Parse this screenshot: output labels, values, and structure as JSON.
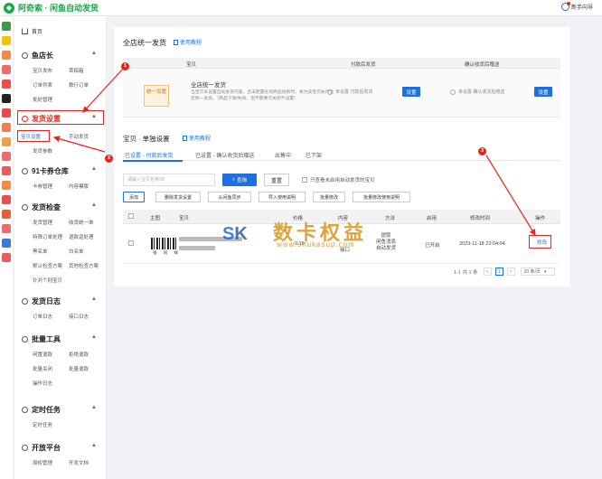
{
  "app": {
    "title": "阿奇索 · 闲鱼自动发货",
    "guide": "新手向导"
  },
  "sidebar": {
    "home": "首页",
    "sections": [
      {
        "title": "鱼店长",
        "items": [
          "宝贝发布",
          "草稿箱",
          "订单列表",
          "数行订单",
          "批处管理"
        ]
      },
      {
        "title": "发货设置",
        "items": [
          "宝贝设置",
          "手动发货",
          "发货参数"
        ]
      },
      {
        "title": "91卡券仓库",
        "items": [
          "卡券管理",
          "内容模版"
        ]
      },
      {
        "title": "发货检查",
        "items": [
          "发货管理",
          "收货统一单",
          "特殊订单处理",
          "退款返处理",
          "黑名单",
          "白名单",
          "默认检查方案",
          "其他检查方案",
          "针对个别宝贝"
        ]
      },
      {
        "title": "发货日志",
        "items": [
          "订单日志",
          "接口日志"
        ]
      },
      {
        "title": "批量工具",
        "items": [
          "闲置退款",
          "拒绝退款",
          "批量关闭",
          "批量退款",
          "操作日志"
        ]
      },
      {
        "title": "定时任务",
        "items": [
          "定时任务"
        ]
      },
      {
        "title": "开放平台",
        "items": [
          "授权管理",
          "开发文档"
        ]
      }
    ]
  },
  "main": {
    "title": "全店统一发货",
    "help_link": "使用教程",
    "store_table": {
      "headers": [
        "宝贝",
        "付款后发货",
        "确认收货后赠送"
      ],
      "unified_tag": "统一设置",
      "desc_title": "全店统一发货",
      "desc_body": "当宝贝未设置自动发货内容，且未配置任何商品规则时，将为该宝贝执行全店统一发货。（商品下架/失效，但不需要可关闭不设置）",
      "after_pay_label": "未设置 付款后发货",
      "after_confirm_label": "未设置 确认收货后赠送",
      "set_button": "设置"
    },
    "item_section": {
      "title": "宝贝 · 单独设置",
      "help_link": "使用教程",
      "tabs": [
        "已设置 - 付款后发货",
        "已设置 - 确认收货后赠送",
        "出售中",
        "已下架"
      ],
      "search_placeholder": "请输入宝贝名称/ID",
      "search_button": "查询",
      "reset_button": "重置",
      "only_show_label": "只查看未启用自动发货的宝贝",
      "action_buttons": [
        "添加",
        "删除发货设置",
        "从闲鱼同步",
        "导入使用说明",
        "批量修改",
        "批量修改使用说明"
      ],
      "columns": [
        "主图",
        "宝贝",
        "价格",
        "内容",
        "方法",
        "启用",
        "修改时间",
        "操作"
      ],
      "rows": [
        {
          "image_caption": "张 同 样",
          "price": "0.10",
          "content": "接口",
          "method": "提取\n闲鱼消息\n自动发货",
          "enabled": "已开启",
          "modified": "2023-11-18 23:04:04",
          "action": "修改"
        }
      ],
      "pager": {
        "summary": "1-1 共 1 条",
        "prev": "<",
        "page": "1",
        "next": ">",
        "page_size": "20 条/页"
      }
    }
  },
  "annotations": {
    "badge1": "1",
    "badge2": "2",
    "badge3": "3",
    "highlight_color": "#e5261f"
  },
  "watermark": {
    "logo_s": "S",
    "logo_k": "K",
    "cn": "数卡权益",
    "url": "www.shukasup.com"
  },
  "colors": {
    "primary": "#1f6fde",
    "brand": "#1aa64a",
    "accent_red": "#e5261f"
  }
}
